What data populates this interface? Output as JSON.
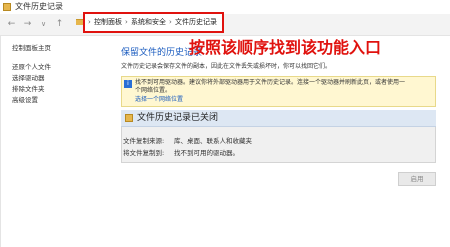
{
  "window": {
    "title": "文件历史记录"
  },
  "nav": {
    "back": "←",
    "forward": "→",
    "dropdown": "∨",
    "up": "↑"
  },
  "breadcrumb": [
    {
      "label": "控制面板"
    },
    {
      "label": "系统和安全"
    },
    {
      "label": "文件历史记录"
    }
  ],
  "breadcrumb_separator": "›",
  "sidebar": {
    "items": [
      {
        "label": "控制面板主页"
      },
      {
        "label": "还原个人文件"
      },
      {
        "label": "选择驱动器"
      },
      {
        "label": "排除文件夹"
      },
      {
        "label": "高级设置"
      }
    ]
  },
  "annotation": "按照该顺序找到该功能入口",
  "main": {
    "heading": "保留文件的历史记录",
    "subtext": "文件历史记录会保存文件的副本，因此在文件丢失或损坏时，你可以找回它们。",
    "info": {
      "line1": "找不到可用驱动器。建议你将外部驱动器用于文件历史记录。连接一个驱动器并刷新此页，或者使用一",
      "line2": "个网络位置。",
      "link": "选择一个网络位置"
    },
    "panel": {
      "title": "文件历史记录已关闭",
      "rows": [
        {
          "label": "文件复制来源:",
          "value": "库、桌面、联系人和收藏夹"
        },
        {
          "label": "将文件复制到:",
          "value": "找不到可用的驱动器。"
        }
      ]
    },
    "enable_button": "启用"
  },
  "colors": {
    "accent": "#1a5bbf",
    "annotation": "#e0120e",
    "info_bg": "#fff7d1",
    "panel_header": "#dde7f3"
  }
}
